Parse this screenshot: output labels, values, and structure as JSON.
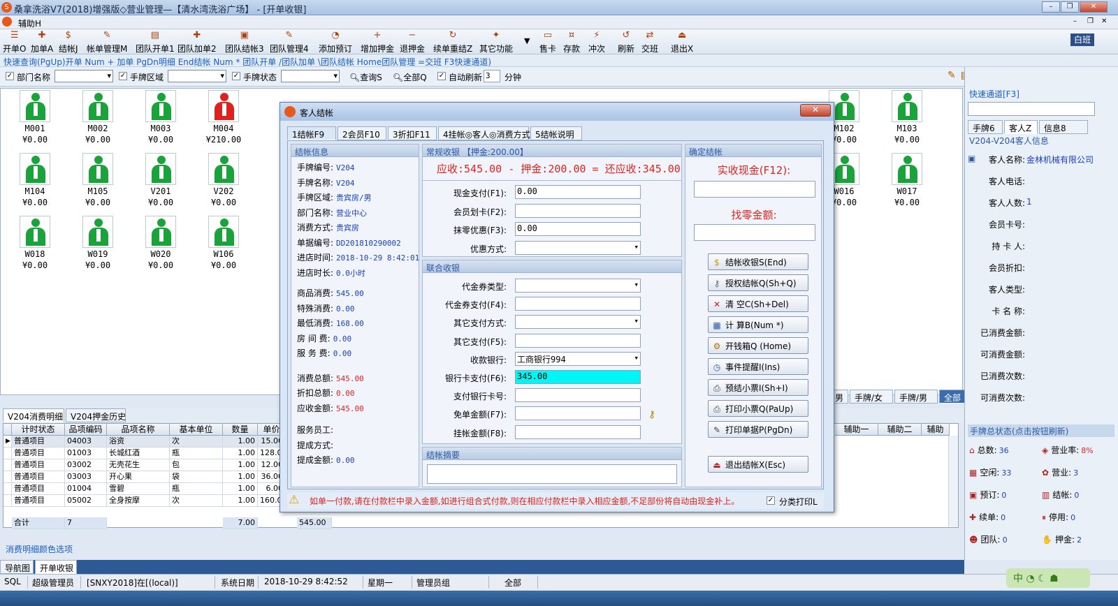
{
  "window": {
    "title": "桑拿洗浴V7(2018)增强版◇营业管理—【清水湾洗浴广场】 - [开单收银]",
    "help_menu": "辅助H",
    "white_btn": "白班"
  },
  "toolbar": [
    {
      "label": "开单O",
      "icon": "☰"
    },
    {
      "label": "加单A",
      "icon": "✚"
    },
    {
      "label": "结帐J",
      "icon": "$"
    },
    {
      "label": "帐单管理M",
      "icon": "✎"
    },
    {
      "label": "团队开单1",
      "icon": "▤"
    },
    {
      "label": "团队加单2",
      "icon": "✚"
    },
    {
      "label": "团队结帐3",
      "icon": "▣"
    },
    {
      "label": "团队管理4",
      "icon": "✎"
    },
    {
      "label": "添加预订",
      "icon": "◔"
    },
    {
      "label": "增加押金",
      "icon": "+"
    },
    {
      "label": "退押金",
      "icon": "−"
    },
    {
      "label": "续单重结Z",
      "icon": "↻"
    },
    {
      "label": "其它功能",
      "icon": "✦"
    },
    {
      "label": "售卡",
      "icon": "▭"
    },
    {
      "label": "存款",
      "icon": "¤"
    },
    {
      "label": "冲次",
      "icon": "⚡"
    },
    {
      "label": "刷新",
      "icon": "↺"
    },
    {
      "label": "交班",
      "icon": "⇄"
    },
    {
      "label": "退出X",
      "icon": "⏏"
    }
  ],
  "shortcut_text": "快速查询(PgUp)开单  Num + 加单  PgDn明细  End结帐  Num * 团队开单  /团队加单  \\团队结帐  Home团队管理  =交班  F3快速通道)",
  "filters": {
    "dept": "部门名称",
    "area": "手牌区域",
    "state": "手牌状态",
    "query": "查询S",
    "all": "全部Q",
    "auto": "自动刷新",
    "mins": "3",
    "unit": "分钟"
  },
  "tiles": [
    [
      "M001",
      "¥0.00",
      "g"
    ],
    [
      "M002",
      "¥0.00",
      "g"
    ],
    [
      "M003",
      "¥0.00",
      "g"
    ],
    [
      "M004",
      "¥210.00",
      "r"
    ],
    [
      "M102",
      "¥0.00",
      "g"
    ],
    [
      "M103",
      "¥0.00",
      "g"
    ],
    [
      "M104",
      "¥0.00",
      "g"
    ],
    [
      "M105",
      "¥0.00",
      "g"
    ],
    [
      "V201",
      "¥0.00",
      "g"
    ],
    [
      "V202",
      "¥0.00",
      "g"
    ],
    [
      "W016",
      "¥0.00",
      "g"
    ],
    [
      "W017",
      "¥0.00",
      "g"
    ],
    [
      "W018",
      "¥0.00",
      "g"
    ],
    [
      "W019",
      "¥0.00",
      "g"
    ],
    [
      "W020",
      "¥0.00",
      "g"
    ],
    [
      "W106",
      "¥0.00",
      "g"
    ]
  ],
  "grid_tabs": [
    "男",
    "手牌/女",
    "手牌/男",
    "全部"
  ],
  "bottom_tabs": [
    "V204消费明细",
    "V204押金历史"
  ],
  "table": {
    "headers": [
      "计时状态",
      "品项编码",
      "品项名称",
      "基本单位",
      "数量",
      "单价"
    ],
    "extra_headers": [
      "辅助一",
      "辅助二",
      "辅助"
    ],
    "rows": [
      [
        "普通项目",
        "04003",
        "浴资",
        "次",
        "1.00",
        "15.00"
      ],
      [
        "普通项目",
        "01003",
        "长城红酒",
        "瓶",
        "1.00",
        "128.00"
      ],
      [
        "普通项目",
        "03002",
        "无壳花生",
        "包",
        "1.00",
        "12.00"
      ],
      [
        "普通项目",
        "03003",
        "开心果",
        "袋",
        "1.00",
        "36.00"
      ],
      [
        "普通项目",
        "01004",
        "雪碧",
        "瓶",
        "1.00",
        "6.00"
      ],
      [
        "普通项目",
        "05002",
        "全身按摩",
        "次",
        "1.00",
        "160.00"
      ]
    ],
    "total_label": "合计",
    "total_count": "7",
    "total_qty": "7.00",
    "total_amount": "545.00"
  },
  "color_options": "消费明细颜色选项",
  "nav_tabs": [
    "导航图",
    "开单收银"
  ],
  "status": {
    "sql": "SQL",
    "user": "超级管理员",
    "db": "[SNXY2018]在[(local)]",
    "date_label": "系统日期",
    "date": "2018-10-29  8:42:52",
    "weekday": "星期一",
    "group": "管理员组",
    "scope": "全部"
  },
  "right": {
    "quick": "快速通道[F3]",
    "tabs": [
      "手牌6",
      "客人Z",
      "信息8"
    ],
    "sub": "V204-V204客人信息",
    "fields": [
      [
        "客人名称:",
        "金林机械有限公司"
      ],
      [
        "客人电话:",
        ""
      ],
      [
        "客人人数:",
        "1"
      ],
      [
        "会员卡号:",
        ""
      ],
      [
        "持 卡 人:",
        ""
      ],
      [
        "会员折扣:",
        ""
      ],
      [
        "客人类型:",
        ""
      ],
      [
        "卡 名 称:",
        ""
      ],
      [
        "已消费金额:",
        ""
      ],
      [
        "可消费金额:",
        ""
      ],
      [
        "已消费次数:",
        ""
      ],
      [
        "可消费次数:",
        ""
      ]
    ],
    "state_title": "手牌总状态(点击按钮刷新)",
    "states": [
      [
        "总数:",
        "36"
      ],
      [
        "营业率:",
        "8%"
      ],
      [
        "空闲:",
        "33"
      ],
      [
        "营业:",
        "3"
      ],
      [
        "预订:",
        "0"
      ],
      [
        "结帐:",
        "0"
      ],
      [
        "续单:",
        "0"
      ],
      [
        "停用:",
        "0"
      ],
      [
        "团队:",
        "0"
      ],
      [
        "押金:",
        "2"
      ]
    ]
  },
  "dialog": {
    "title": "客人结帐",
    "tabs": [
      "1结帐F9",
      "2会员F10",
      "3折扣F11",
      "4挂帐◎客人◎消费方式",
      "5结帐说明"
    ],
    "info_title": "结帐信息",
    "info": [
      [
        "手牌编号:",
        "V204"
      ],
      [
        "手牌名称:",
        "V204"
      ],
      [
        "手牌区域:",
        "贵宾房/男"
      ],
      [
        "部门名称:",
        "营业中心"
      ],
      [
        "消费方式:",
        "贵宾房"
      ],
      [
        "单据编号:",
        "DD201810290002"
      ],
      [
        "进店时间:",
        "2018-10-29 8:42:01"
      ],
      [
        "进店时长:",
        "0.0小时"
      ]
    ],
    "info2": [
      [
        "商品消费:",
        "545.00"
      ],
      [
        "特殊消费:",
        "0.00"
      ],
      [
        "最低消费:",
        "168.00"
      ],
      [
        "房 间 费:",
        "0.00"
      ],
      [
        "服 务 费:",
        "0.00"
      ]
    ],
    "info3": [
      [
        "消费总额:",
        "545.00"
      ],
      [
        "折扣总额:",
        "0.00"
      ],
      [
        "应收金额:",
        "545.00"
      ]
    ],
    "info4": [
      [
        "服务员工:",
        ""
      ],
      [
        "提成方式:",
        ""
      ],
      [
        "提成金额:",
        "0.00"
      ]
    ],
    "normal_title": "常规收银 【押金:200.00】",
    "summary": "应收:545.00 - 押金:200.00 = 还应收:345.00",
    "normal": [
      [
        "现金支付(F1):",
        "0.00"
      ],
      [
        "会员划卡(F2):",
        ""
      ],
      [
        "抹零优惠(F3):",
        "0.00"
      ],
      [
        "优惠方式:",
        ""
      ]
    ],
    "combo_title": "联合收银",
    "combo": [
      [
        "代金券类型:",
        ""
      ],
      [
        "代金券支付(F4):",
        ""
      ],
      [
        "其它支付方式:",
        ""
      ],
      [
        "其它支付(F5):",
        ""
      ],
      [
        "收款银行:",
        "工商银行994"
      ],
      [
        "银行卡支付(F6):",
        "345.00"
      ],
      [
        "支付银行卡号:",
        ""
      ],
      [
        "免单金额(F7):",
        ""
      ],
      [
        "挂帐金额(F8):",
        ""
      ]
    ],
    "memo_title": "结帐摘要",
    "confirm_title": "确定结帐",
    "cash_label": "实收现金(F12):",
    "change_label": "找零金额:",
    "buttons": [
      [
        "结帐收银S(End)",
        "$"
      ],
      [
        "授权结帐Q(Sh+Q)",
        "⚷"
      ],
      [
        "清  空C(Sh+Del)",
        "✕"
      ],
      [
        "计  算B(Num *)",
        "▦"
      ],
      [
        "开钱箱Q (Home)",
        "⚙"
      ],
      [
        "事件提醒I(Ins)",
        "◷"
      ],
      [
        "预结小票I(Sh+I)",
        "⎙"
      ],
      [
        "打印小票Q(PaUp)",
        "⎙"
      ],
      [
        "打印单据P(PgDn)",
        "✎"
      ]
    ],
    "exit_btn": "退出结帐X(Esc)",
    "warning": "如单一付款,请在付款栏中录入金额,如进行组合式付款,则在相应付款栏中录入相应金额,不足部份将自动由现金补上。",
    "print_cls": "分类打印L"
  },
  "colors": {
    "accent": "#2a58a8",
    "red": "#e0221e",
    "highlight": "#00f5f5"
  }
}
